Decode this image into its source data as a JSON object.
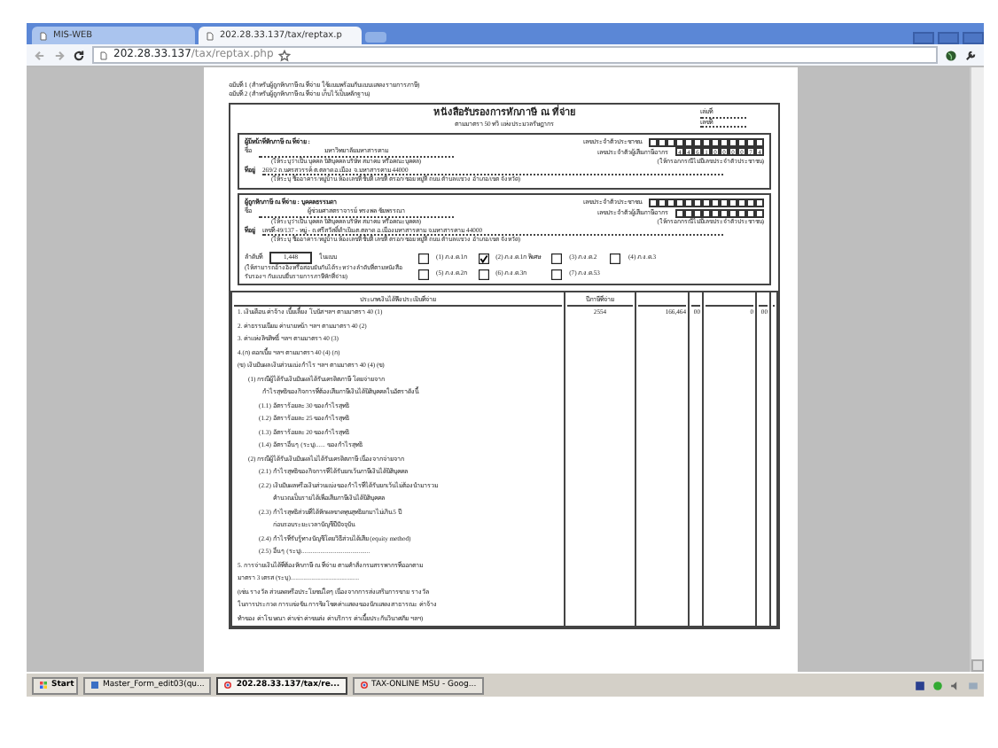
{
  "browser": {
    "tabs": [
      {
        "title": "MIS-WEB",
        "selected": false
      },
      {
        "title": "202.28.33.137/tax/reptax.p",
        "selected": true
      }
    ],
    "url_host": "202.28.33.137",
    "url_path": "/tax/reptax.php"
  },
  "form": {
    "copy_notes": [
      "ฉบับที่ 1 (สำหรับผู้ถูกหักภาษี ณ ที่จ่าย ใช้แนบพร้อมกับแบบแสดงรายการภาษี)",
      "ฉบับที่ 2 (สำหรับผู้ถูกหักภาษี ณ ที่จ่าย เก็บไว้เป็นหลักฐาน)"
    ],
    "title": "หนังสือรับรองการหักภาษี ณ ที่จ่าย",
    "subtitle": "ตามมาตรา 50 ทวิ แห่งประมวลรัษฎากร",
    "book_label": "เล่มที่",
    "number_label": "เลขที่",
    "parties": [
      {
        "heading": "ผู้มีหน้าที่หักภาษี ณ ที่จ่าย :",
        "name_label": "ชื่อ",
        "name": "มหาวิทยาลัยมหาสารคาม",
        "name_hint": "(ให้ระบุว่าเป็น บุคคล นิติบุคคล บริษัท สมาคม หรือคณะบุคคล)",
        "id_label": "เลขประจำตัวประชาชน",
        "tax_id_label": "เลขประจำตัวผู้เสียภาษีอากร",
        "tax_id_digits": [
          "4",
          "4",
          "6",
          "1",
          "0",
          "0",
          "0",
          "0",
          "7",
          "4"
        ],
        "tax_id_hint": "(ให้กรอกกรณีไม่มีเลขประจำตัวประชาชน)",
        "address_label": "ที่อยู่",
        "address": "269/2 ถ.นครสวรรค์ ต.ตลาด อ.เมือง จ.มหาสารคาม 44000",
        "address_hint": "(ให้ระบุ ชื่ออาคาร/หมู่บ้าน ห้องเลขที่ ชั้นที่ เลขที่ ตรอก/ซอย หมู่ที่ ถนน ตำบล/แขวง อำเภอ/เขต จังหวัด)"
      },
      {
        "heading": "ผู้ถูกหักภาษี ณ ที่จ่าย : บุคคลธรรมดา",
        "name_label": "ชื่อ",
        "name": "ผู้ช่วยศาสตราจารย์ ทรงพล ชัยพรรณา",
        "name_hint": "(ให้ระบุว่าเป็น บุคคล นิติบุคคล บริษัท สมาคม หรือคณะบุคคล)",
        "id_label": "เลขประจำตัวประชาชน",
        "tax_id_label": "เลขประจำตัวผู้เสียภาษีอากร",
        "tax_id_hint": "(ให้กรอกกรณีไม่มีเลขประจำตัวประชาชน)",
        "address_label": "ที่อยู่",
        "address": "เลขที่ 49/137 - หมู่ - ถ.ศรีสวัสดิ์ดำเนิน ต.ตลาด อ.เมืองมหาสารคาม จ.มหาสารคาม 44000",
        "address_hint": "(ให้ระบุ ชื่ออาคาร/หมู่บ้าน ห้องเลขที่ ชั้นที่ เลขที่ ตรอก/ซอย หมู่ที่ ถนน ตำบล/แขวง อำเภอ/เขต จังหวัด)"
      }
    ],
    "seq_label": "ลำดับที่",
    "seq_value": "1,448",
    "seq_in_form": "ในแบบ",
    "seq_hint": "(ให้สามารถอ้างอิงหรือสอบยันกันได้ระหว่างลำดับที่ตามหนังสือรับรองฯ กับแบบยื่นรายการภาษีหักที่จ่าย)",
    "form_types": [
      {
        "label": "(1) ภ.ง.ด.1ก",
        "checked": false
      },
      {
        "label": "(2) ภ.ง.ด.1ก พิเศษ",
        "checked": true
      },
      {
        "label": "(3) ภ.ง.ด.2",
        "checked": false
      },
      {
        "label": "(4) ภ.ง.ด.3",
        "checked": false
      },
      {
        "label": "(5) ภ.ง.ด.2ก",
        "checked": false
      },
      {
        "label": "(6) ภ.ง.ด.3ก",
        "checked": false
      },
      {
        "label": "(7) ภ.ง.ด.53",
        "checked": false
      }
    ],
    "table": {
      "columns": [
        "ประเภทเงินได้พึงประเมินที่จ่าย",
        "ปีภาษีที่จ่าย"
      ],
      "rows": [
        {
          "lines": [
            "1. เงินเดือน ค่าจ้าง เบี้ยเลี้ยง โบนัส ฯลฯ ตามมาตรา 40 (1)"
          ],
          "year": "2554",
          "amount": "166,464",
          "amount_satang": "00",
          "tax": "0",
          "tax_satang": "00"
        },
        {
          "lines": [
            "2. ค่าธรรมเนียม ค่านายหน้า ฯลฯ ตามมาตรา 40 (2)"
          ]
        },
        {
          "lines": [
            "3. ค่าแห่งลิขสิทธิ์ ฯลฯ ตามมาตรา 40 (3)"
          ]
        },
        {
          "lines": [
            "4.(ก) ดอกเบี้ย ฯลฯ ตามมาตรา 40 (4) (ก)"
          ]
        },
        {
          "lines": [
            "(ข) เงินปันผล เงินส่วนแบ่งกำไร ฯลฯ ตามมาตรา 40 (4) (ข)"
          ],
          "children": [
            {
              "lines": [
                "(1) กรณีผู้ได้รับเงินปันผลได้รับเครดิตภาษี โดยจ่ายจาก",
                "กำไรสุทธิของกิจการที่ต้องเสียภาษีเงินได้นิติบุคคลในอัตราดังนี้"
              ],
              "children": [
                {
                  "lines": [
                    "(1.1) อัตราร้อยละ 30 ของกำไรสุทธิ"
                  ]
                },
                {
                  "lines": [
                    "(1.2) อัตราร้อยละ 25 ของกำไรสุทธิ"
                  ]
                },
                {
                  "lines": [
                    "(1.3) อัตราร้อยละ 20 ของกำไรสุทธิ"
                  ]
                },
                {
                  "lines": [
                    "(1.4) อัตราอื่น ๆ (ระบุ)...... ของกำไรสุทธิ"
                  ]
                }
              ]
            },
            {
              "lines": [
                "(2) กรณีผู้ได้รับเงินปันผลไม่ได้รับเครดิตภาษี เนื่องจากจ่ายจาก"
              ],
              "children": [
                {
                  "lines": [
                    "(2.1) กำไรสุทธิของกิจการที่ได้รับยกเว้นภาษีเงินได้นิติบุคคล"
                  ]
                },
                {
                  "lines": [
                    "(2.2) เงินปันผลหรือเงินส่วนแบ่งของกำไรที่ได้รับยกเว้นไม่ต้องนำมารวม",
                    "คำนวณเป็นรายได้เพื่อเสียภาษีเงินได้นิติบุคคล"
                  ]
                },
                {
                  "lines": [
                    "(2.3) กำไรสุทธิส่วนที่ได้หักผลขาดทุนสุทธิยกมาไม่เกิน 5 ปี",
                    "ก่อนรอบระยะเวลาบัญชีปีปัจจุบัน"
                  ]
                },
                {
                  "lines": [
                    "(2.4) กำไรที่รับรู้ทางบัญชีโดยวิธีส่วนได้เสีย (equity method)"
                  ]
                },
                {
                  "lines": [
                    "(2.5) อื่น ๆ (ระบุ)..........................................."
                  ]
                }
              ]
            }
          ]
        },
        {
          "lines": [
            "5. การจ่ายเงินได้ที่ต้องหักภาษี ณ ที่จ่าย ตามคำสั่งกรมสรรพากรที่ออกตาม",
            "มาตรา 3 เตรส (ระบุ)...........................................",
            "(เช่น รางวัล ส่วนลดหรือประโยชน์ใดๆ เนื่องจากการส่งเสริมการขาย รางวัล",
            "ในการประกวด การแข่งขัน การชิงโชค ค่าแสดงของนักแสดงสาธารณะ ค่าจ้าง",
            "ทำของ ค่าโฆษณา ค่าเช่า ค่าขนส่ง ค่าบริการ ค่าเบี้ยประกันวินาศภัย ฯลฯ)"
          ]
        }
      ]
    }
  },
  "taskbar": {
    "start": "Start",
    "items": [
      {
        "label": "Master_Form_edit03(qu...",
        "selected": false
      },
      {
        "label": "202.28.33.137/tax/re...",
        "selected": true
      },
      {
        "label": "TAX-ONLINE MSU - Goog...",
        "selected": false
      }
    ]
  }
}
